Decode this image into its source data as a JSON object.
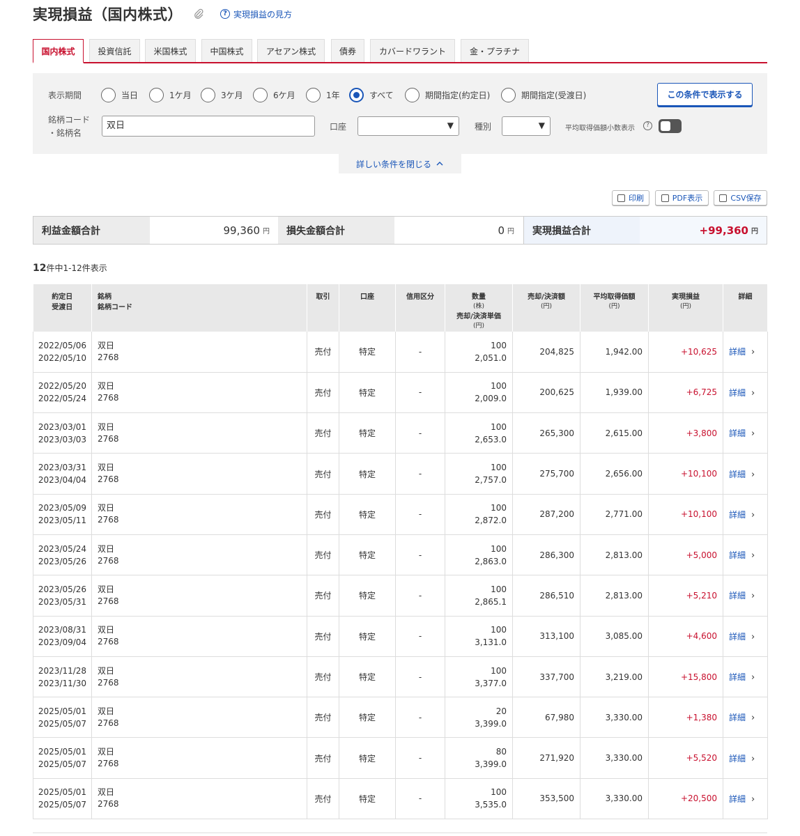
{
  "header": {
    "title": "実現損益（国内株式）",
    "help_link": "実現損益の見方"
  },
  "tabs": [
    "国内株式",
    "投資信託",
    "米国株式",
    "中国株式",
    "アセアン株式",
    "債券",
    "カバードワラント",
    "金・プラチナ"
  ],
  "filter": {
    "period_label": "表示期間",
    "period_options": [
      "当日",
      "1ケ月",
      "3ケ月",
      "6ケ月",
      "1年",
      "すべて",
      "期間指定(約定日)",
      "期間指定(受渡日)"
    ],
    "selected_period": "すべて",
    "apply_button": "この条件で表示する",
    "code_label_1": "銘柄コード",
    "code_label_2": "・銘柄名",
    "code_value": "双日",
    "account_label": "口座",
    "account_value": "",
    "type_label": "種別",
    "type_value": "",
    "decimal_label": "平均取得価額小数表示",
    "collapse_link": "詳しい条件を閉じる"
  },
  "tools": {
    "print": "印刷",
    "pdf": "PDF表示",
    "csv": "CSV保存"
  },
  "summary": {
    "profit_label": "利益金額合計",
    "profit_value": "99,360",
    "loss_label": "損失金額合計",
    "loss_value": "0",
    "net_label": "実現損益合計",
    "net_value": "+99,360",
    "unit": "円"
  },
  "count": {
    "total": "12",
    "text": "件中1-12件表示"
  },
  "table": {
    "headers": {
      "date1": "約定日",
      "date2": "受渡日",
      "name1": "銘柄",
      "name2": "銘柄コード",
      "trade": "取引",
      "account": "口座",
      "margin": "信用区分",
      "qty": "数量",
      "qty_unit": "(株)",
      "price": "売却/決済単価",
      "price_unit": "(円)",
      "amount": "売却/決済額",
      "amount_unit": "(円)",
      "avg": "平均取得価額",
      "avg_unit": "(円)",
      "pl": "実現損益",
      "pl_unit": "(円)",
      "detail": "詳細"
    },
    "rows": [
      {
        "trade_date": "2022/05/06",
        "settle_date": "2022/05/10",
        "name": "双日",
        "code": "2768",
        "trade": "売付",
        "account": "特定",
        "margin": "-",
        "qty": "100",
        "price": "2,051.0",
        "amount": "204,825",
        "avg": "1,942.00",
        "pl": "+10,625",
        "detail": "詳細"
      },
      {
        "trade_date": "2022/05/20",
        "settle_date": "2022/05/24",
        "name": "双日",
        "code": "2768",
        "trade": "売付",
        "account": "特定",
        "margin": "-",
        "qty": "100",
        "price": "2,009.0",
        "amount": "200,625",
        "avg": "1,939.00",
        "pl": "+6,725",
        "detail": "詳細"
      },
      {
        "trade_date": "2023/03/01",
        "settle_date": "2023/03/03",
        "name": "双日",
        "code": "2768",
        "trade": "売付",
        "account": "特定",
        "margin": "-",
        "qty": "100",
        "price": "2,653.0",
        "amount": "265,300",
        "avg": "2,615.00",
        "pl": "+3,800",
        "detail": "詳細"
      },
      {
        "trade_date": "2023/03/31",
        "settle_date": "2023/04/04",
        "name": "双日",
        "code": "2768",
        "trade": "売付",
        "account": "特定",
        "margin": "-",
        "qty": "100",
        "price": "2,757.0",
        "amount": "275,700",
        "avg": "2,656.00",
        "pl": "+10,100",
        "detail": "詳細"
      },
      {
        "trade_date": "2023/05/09",
        "settle_date": "2023/05/11",
        "name": "双日",
        "code": "2768",
        "trade": "売付",
        "account": "特定",
        "margin": "-",
        "qty": "100",
        "price": "2,872.0",
        "amount": "287,200",
        "avg": "2,771.00",
        "pl": "+10,100",
        "detail": "詳細"
      },
      {
        "trade_date": "2023/05/24",
        "settle_date": "2023/05/26",
        "name": "双日",
        "code": "2768",
        "trade": "売付",
        "account": "特定",
        "margin": "-",
        "qty": "100",
        "price": "2,863.0",
        "amount": "286,300",
        "avg": "2,813.00",
        "pl": "+5,000",
        "detail": "詳細"
      },
      {
        "trade_date": "2023/05/26",
        "settle_date": "2023/05/31",
        "name": "双日",
        "code": "2768",
        "trade": "売付",
        "account": "特定",
        "margin": "-",
        "qty": "100",
        "price": "2,865.1",
        "amount": "286,510",
        "avg": "2,813.00",
        "pl": "+5,210",
        "detail": "詳細"
      },
      {
        "trade_date": "2023/08/31",
        "settle_date": "2023/09/04",
        "name": "双日",
        "code": "2768",
        "trade": "売付",
        "account": "特定",
        "margin": "-",
        "qty": "100",
        "price": "3,131.0",
        "amount": "313,100",
        "avg": "3,085.00",
        "pl": "+4,600",
        "detail": "詳細"
      },
      {
        "trade_date": "2023/11/28",
        "settle_date": "2023/11/30",
        "name": "双日",
        "code": "2768",
        "trade": "売付",
        "account": "特定",
        "margin": "-",
        "qty": "100",
        "price": "3,377.0",
        "amount": "337,700",
        "avg": "3,219.00",
        "pl": "+15,800",
        "detail": "詳細"
      },
      {
        "trade_date": "2025/05/01",
        "settle_date": "2025/05/07",
        "name": "双日",
        "code": "2768",
        "trade": "売付",
        "account": "特定",
        "margin": "-",
        "qty": "20",
        "price": "3,399.0",
        "amount": "67,980",
        "avg": "3,330.00",
        "pl": "+1,380",
        "detail": "詳細"
      },
      {
        "trade_date": "2025/05/01",
        "settle_date": "2025/05/07",
        "name": "双日",
        "code": "2768",
        "trade": "売付",
        "account": "特定",
        "margin": "-",
        "qty": "80",
        "price": "3,399.0",
        "amount": "271,920",
        "avg": "3,330.00",
        "pl": "+5,520",
        "detail": "詳細"
      },
      {
        "trade_date": "2025/05/01",
        "settle_date": "2025/05/07",
        "name": "双日",
        "code": "2768",
        "trade": "売付",
        "account": "特定",
        "margin": "-",
        "qty": "100",
        "price": "3,535.0",
        "amount": "353,500",
        "avg": "3,330.00",
        "pl": "+20,500",
        "detail": "詳細"
      }
    ]
  },
  "colors": {
    "accent_red": "#c8102e",
    "link_blue": "#1a56b8"
  },
  "icons": [
    "paperclip-icon",
    "help-icon",
    "print-icon",
    "pdf-icon",
    "csv-icon",
    "chevron-right-icon",
    "chevron-up-icon",
    "dropdown-arrow-icon",
    "question-icon"
  ]
}
